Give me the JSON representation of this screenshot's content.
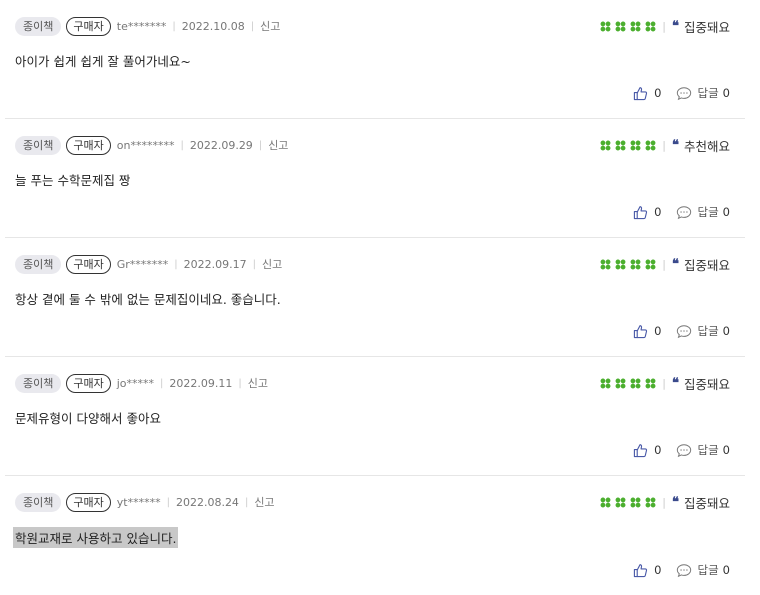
{
  "colors": {
    "clover": "#4caf2f",
    "quote": "#3a4a8c"
  },
  "reviews": [
    {
      "format": "종이책",
      "buyer_badge": "구매자",
      "user": "te*******",
      "date": "2022.10.08",
      "report": "신고",
      "tag_icon": "❝",
      "tag": "집중돼요",
      "rating": 4,
      "text": "아이가 쉽게 쉽게 잘 풀어가네요~",
      "likes": "0",
      "reply_label": "답글",
      "replies": "0"
    },
    {
      "format": "종이책",
      "buyer_badge": "구매자",
      "user": "on********",
      "date": "2022.09.29",
      "report": "신고",
      "tag_icon": "❝",
      "tag": "추천해요",
      "rating": 4,
      "text": "늘 푸는 수학문제집 짱",
      "likes": "0",
      "reply_label": "답글",
      "replies": "0"
    },
    {
      "format": "종이책",
      "buyer_badge": "구매자",
      "user": "Gr*******",
      "date": "2022.09.17",
      "report": "신고",
      "tag_icon": "❝",
      "tag": "집중돼요",
      "rating": 4,
      "text": "항상 곁에 둘 수 밖에 없는 문제집이네요. 좋습니다.",
      "likes": "0",
      "reply_label": "답글",
      "replies": "0"
    },
    {
      "format": "종이책",
      "buyer_badge": "구매자",
      "user": "jo*****",
      "date": "2022.09.11",
      "report": "신고",
      "tag_icon": "❝",
      "tag": "집중돼요",
      "rating": 4,
      "text": "문제유형이 다양해서 좋아요",
      "likes": "0",
      "reply_label": "답글",
      "replies": "0"
    },
    {
      "format": "종이책",
      "buyer_badge": "구매자",
      "user": "yt******",
      "date": "2022.08.24",
      "report": "신고",
      "tag_icon": "❝",
      "tag": "집중돼요",
      "rating": 4,
      "text": "학원교재로 사용하고 있습니다.",
      "likes": "0",
      "reply_label": "답글",
      "replies": "0",
      "text_selected": true
    }
  ]
}
